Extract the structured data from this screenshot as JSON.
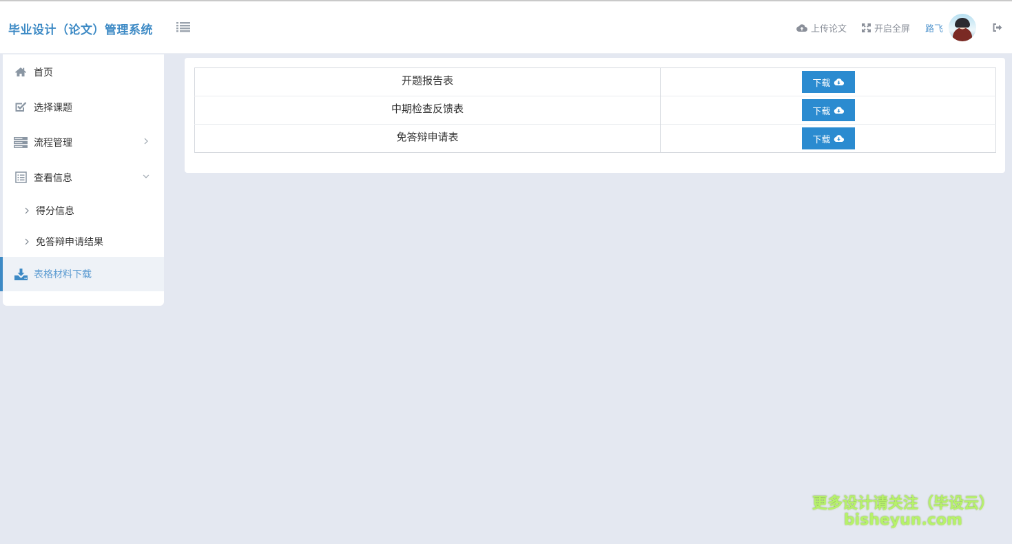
{
  "app": {
    "title": "毕业设计（论文）管理系统"
  },
  "header": {
    "upload_label": "上传论文",
    "fullscreen_label": "开启全屏",
    "user_name": "路飞"
  },
  "sidebar": {
    "items": [
      {
        "label": "首页",
        "icon": "home-icon"
      },
      {
        "label": "选择课题",
        "icon": "check-square-icon"
      },
      {
        "label": "流程管理",
        "icon": "server-icon"
      },
      {
        "label": "查看信息",
        "icon": "list-alt-icon"
      },
      {
        "label": "表格材料下载",
        "icon": "download-icon"
      }
    ],
    "sub_items": [
      {
        "label": "得分信息"
      },
      {
        "label": "免答辩申请结果"
      }
    ]
  },
  "downloads": {
    "rows": [
      {
        "name": "开题报告表",
        "button": "下载"
      },
      {
        "name": "中期检查反馈表",
        "button": "下载"
      },
      {
        "name": "免答辩申请表",
        "button": "下载"
      }
    ]
  },
  "watermark": {
    "line1": "更多设计请关注（毕设云）",
    "line2": "bisheyun.com"
  },
  "colors": {
    "brand": "#3d8ac5",
    "button": "#2b8bd0",
    "page_bg": "#e4e8f1",
    "active_text": "#5b9bd1"
  }
}
